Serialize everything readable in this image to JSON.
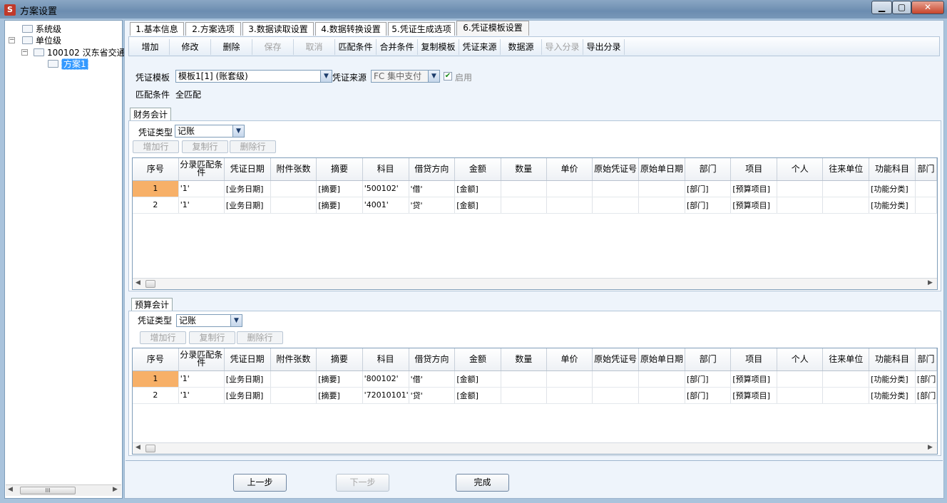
{
  "window": {
    "title": "方案设置",
    "app_icon": "S",
    "minimize": "▁",
    "maximize": "▢",
    "close": "✕"
  },
  "tree": {
    "nodes": [
      {
        "label": "系统级"
      },
      {
        "label": "单位级"
      },
      {
        "label": "100102 汉东省交通"
      },
      {
        "label": "方案1"
      }
    ],
    "expander_minus": "−",
    "scroll_thumb": "III"
  },
  "tabs": [
    {
      "label": "1.基本信息"
    },
    {
      "label": "2.方案选项"
    },
    {
      "label": "3.数据读取设置"
    },
    {
      "label": "4.数据转换设置"
    },
    {
      "label": "5.凭证生成选项"
    },
    {
      "label": "6.凭证模板设置"
    }
  ],
  "toolbar": {
    "buttons": [
      {
        "label": "增加"
      },
      {
        "label": "修改"
      },
      {
        "label": "删除"
      },
      {
        "label": "保存"
      },
      {
        "label": "取消"
      },
      {
        "label": "匹配条件"
      },
      {
        "label": "合并条件"
      },
      {
        "label": "复制模板"
      },
      {
        "label": "凭证来源"
      },
      {
        "label": "数据源"
      },
      {
        "label": "导入分录"
      },
      {
        "label": "导出分录"
      }
    ]
  },
  "template": {
    "label": "凭证模板",
    "value": "模板1[1] (账套级)",
    "source_label": "凭证来源",
    "source_value": "FC 集中支付",
    "enabled_label": "启用",
    "enabled_check": "✔",
    "match_label": "匹配条件",
    "match_value": "全匹配"
  },
  "columns": [
    "序号",
    "分录匹配条件",
    "凭证日期",
    "附件张数",
    "摘要",
    "科目",
    "借贷方向",
    "金额",
    "数量",
    "单价",
    "原始凭证号",
    "原始单日期",
    "部门",
    "项目",
    "个人",
    "往来单位",
    "功能科目",
    "部门"
  ],
  "financial": {
    "tab": "财务会计",
    "voucher_type_label": "凭证类型",
    "voucher_type_value": "记账",
    "add_row": "增加行",
    "copy_row": "复制行",
    "delete_row": "删除行",
    "rows": [
      [
        "1",
        "'1'",
        "[业务日期]",
        "",
        "[摘要]",
        "'500102'",
        "'借'",
        "[金额]",
        "",
        "",
        "",
        "",
        "[部门]",
        "[预算项目]",
        "",
        "",
        "[功能分类]",
        ""
      ],
      [
        "2",
        "'1'",
        "[业务日期]",
        "",
        "[摘要]",
        "'4001'",
        "'贷'",
        "[金额]",
        "",
        "",
        "",
        "",
        "[部门]",
        "[预算项目]",
        "",
        "",
        "[功能分类]",
        ""
      ]
    ]
  },
  "budget": {
    "tab": "预算会计",
    "voucher_type_label": "凭证类型",
    "voucher_type_value": "记账",
    "add_row": "增加行",
    "copy_row": "复制行",
    "delete_row": "删除行",
    "rows": [
      [
        "1",
        "'1'",
        "[业务日期]",
        "",
        "[摘要]",
        "'800102'",
        "'借'",
        "[金额]",
        "",
        "",
        "",
        "",
        "[部门]",
        "[预算项目]",
        "",
        "",
        "[功能分类]",
        "[部门"
      ],
      [
        "2",
        "'1'",
        "[业务日期]",
        "",
        "[摘要]",
        "'72010101'",
        "'贷'",
        "[金额]",
        "",
        "",
        "",
        "",
        "[部门]",
        "[预算项目]",
        "",
        "",
        "[功能分类]",
        "[部门"
      ]
    ]
  },
  "scroll": {
    "left": "◀",
    "right": "▶"
  },
  "footer": {
    "prev": "上一步",
    "next": "下一步",
    "finish": "完成"
  },
  "icons": {
    "dropdown": "▼"
  }
}
